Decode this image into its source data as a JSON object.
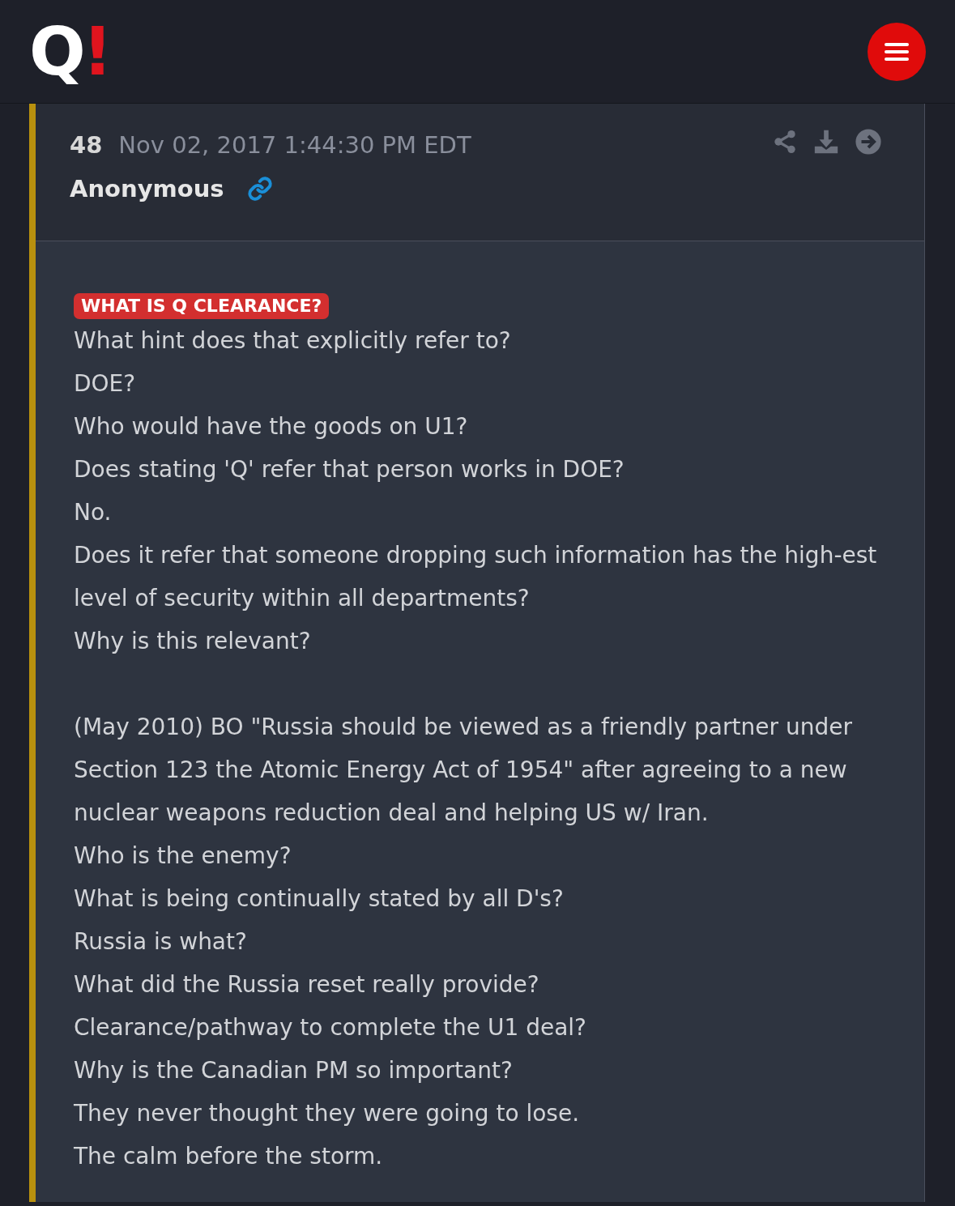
{
  "logo": {
    "letter": "Q",
    "mark": "!"
  },
  "post": {
    "number": "48",
    "date": "Nov 02, 2017 1:44:30 PM EDT",
    "author": "Anonymous",
    "tag": "WHAT IS Q CLEARANCE?",
    "blocks": [
      [
        "What hint does that explicitly refer to?",
        "DOE?",
        "Who would have the goods on U1?",
        "Does stating 'Q' refer that person works in DOE?",
        "No.",
        "Does it refer that someone dropping such information has the high-est level of security within all departments?",
        "Why is this relevant?"
      ],
      [
        "(May 2010) BO \"Russia should be viewed as a friendly partner under Section 123 the Atomic Energy Act of 1954\" after agreeing to a new nuclear weapons reduction deal and helping US w/ Iran.",
        "Who is the enemy?",
        "What is being continually stated by all D's?",
        "Russia is what?",
        "What did the Russia reset really provide?",
        "Clearance/pathway to complete the U1 deal?",
        "Why is the Canadian PM so important?",
        "They never thought they were going to lose.",
        "The calm before the storm."
      ]
    ]
  }
}
